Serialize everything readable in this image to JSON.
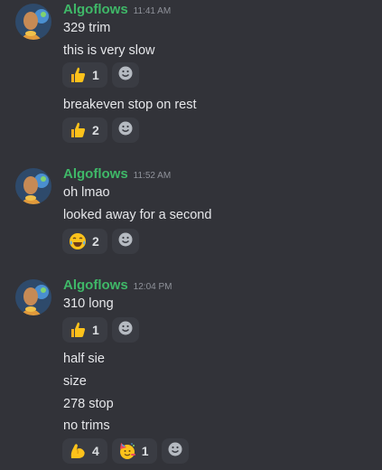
{
  "messages": [
    {
      "author": "Algoflows",
      "time": "11:41 AM",
      "lines": [
        "329 trim",
        "this is very slow",
        "breakeven stop on rest"
      ],
      "reactions_a": [
        {
          "emoji": "thumbs-up",
          "count": "1"
        }
      ],
      "reactions_b": [
        {
          "emoji": "thumbs-up",
          "count": "2"
        }
      ]
    },
    {
      "author": "Algoflows",
      "time": "11:52 AM",
      "lines": [
        "oh lmao",
        "looked away for a second"
      ],
      "reactions_a": [
        {
          "emoji": "joy",
          "count": "2"
        }
      ]
    },
    {
      "author": "Algoflows",
      "time": "12:04 PM",
      "lines": [
        "310 long",
        "half sie",
        "size",
        "278 stop",
        "no trims"
      ],
      "reactions_a": [
        {
          "emoji": "thumbs-up",
          "count": "1"
        }
      ],
      "reactions_b": [
        {
          "emoji": "flexed-biceps",
          "count": "4"
        },
        {
          "emoji": "partying-face",
          "count": "1"
        }
      ]
    }
  ],
  "icons": {
    "add_reaction": "smile-plus-icon"
  },
  "colors": {
    "background": "#323339",
    "author": "#3fb868",
    "timestamp": "#8f929a",
    "reaction_bg": "#3a3c43"
  }
}
